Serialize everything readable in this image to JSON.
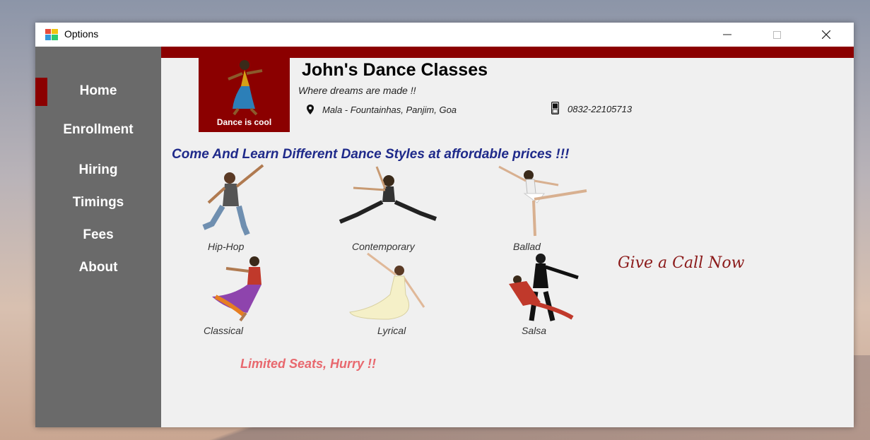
{
  "window": {
    "title": "Options"
  },
  "sidebar": {
    "items": [
      {
        "label": "Home",
        "active": true
      },
      {
        "label": "Enrollment"
      },
      {
        "label": "Hiring"
      },
      {
        "label": "Timings"
      },
      {
        "label": "Fees"
      },
      {
        "label": "About"
      }
    ]
  },
  "logo": {
    "caption": "Dance is cool"
  },
  "header": {
    "school_name": "John's Dance Classes",
    "tagline": "Where dreams are made !!",
    "address": "Mala - Fountainhas, Panjim, Goa",
    "phone": "0832-22105713"
  },
  "main": {
    "headline": "Come And Learn Different Dance Styles at affordable prices !!!",
    "styles": [
      {
        "label": "Hip-Hop"
      },
      {
        "label": "Contemporary"
      },
      {
        "label": "Ballad"
      },
      {
        "label": "Classical"
      },
      {
        "label": "Lyrical"
      },
      {
        "label": "Salsa"
      }
    ],
    "call_now": "Give a Call Now",
    "limited_seats": "Limited Seats, Hurry !!"
  },
  "colors": {
    "sidebar": "#6a6a6a",
    "accent": "#8b0000",
    "headline": "#1f2a8a",
    "call_now": "#8b1a1a",
    "limited": "#e8686e"
  }
}
